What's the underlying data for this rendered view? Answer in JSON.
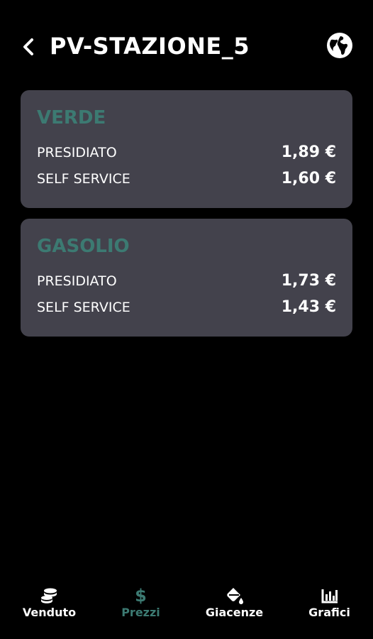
{
  "header": {
    "title": "PV-STAZIONE_5",
    "back_icon": "chevron-left-icon",
    "globe_icon": "globe-icon"
  },
  "colors": {
    "background": "#000000",
    "card": "#43424c",
    "accent": "#3c7a72",
    "text": "#ffffff",
    "nav_inactive": "#ffffff"
  },
  "cards": [
    {
      "title": "VERDE",
      "rows": [
        {
          "label": "PRESIDIATO",
          "value": "1,89 €"
        },
        {
          "label": "SELF SERVICE",
          "value": "1,60 €"
        }
      ]
    },
    {
      "title": "GASOLIO",
      "rows": [
        {
          "label": "PRESIDIATO",
          "value": "1,73 €"
        },
        {
          "label": "SELF SERVICE",
          "value": "1,43 €"
        }
      ]
    }
  ],
  "nav": {
    "items": [
      {
        "label": "Venduto",
        "icon": "coins-icon",
        "active": false
      },
      {
        "label": "Prezzi",
        "icon": "dollar-icon",
        "active": true
      },
      {
        "label": "Giacenze",
        "icon": "paint-bucket-icon",
        "active": false
      },
      {
        "label": "Grafici",
        "icon": "bar-chart-icon",
        "active": false
      }
    ]
  }
}
